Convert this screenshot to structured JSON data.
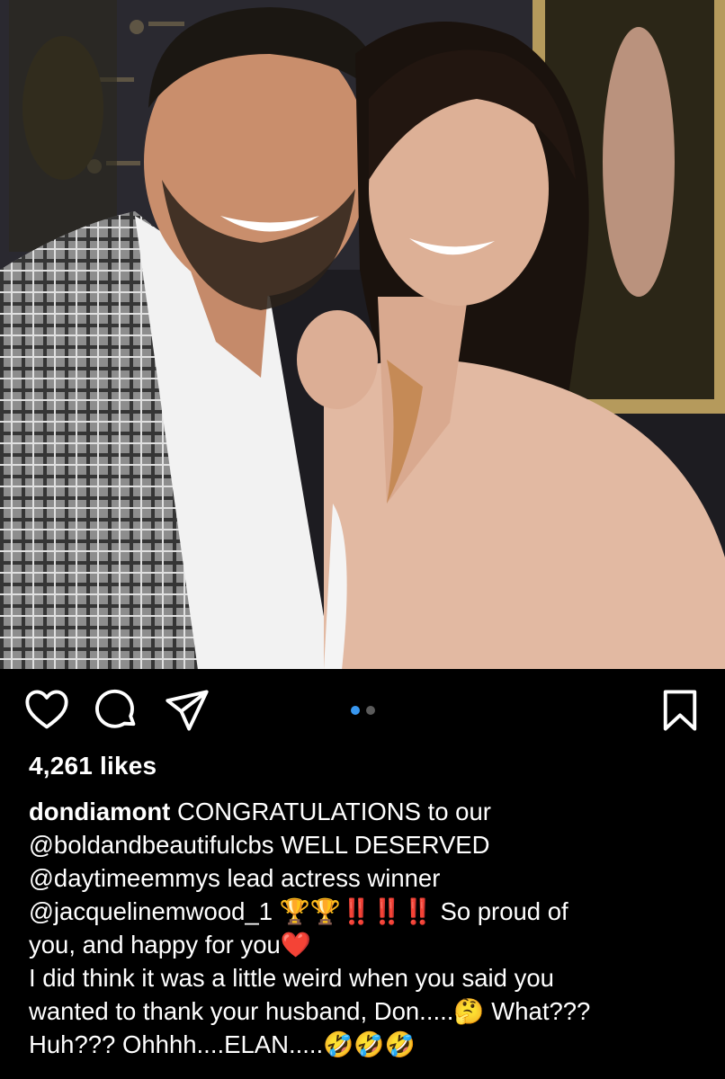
{
  "post": {
    "likes_text": "4,261 likes",
    "carousel": {
      "count": 2,
      "active_index": 0
    },
    "caption": {
      "username": "dondiamont",
      "line1": "CONGRATULATIONS to our",
      "line2": "@boldandbeautifulcbs WELL DESERVED",
      "line3": "@daytimeemmys lead actress winner",
      "line4": "@jacquelinemwood_1 🏆🏆‼️‼️‼️ So proud of",
      "line5": "you, and happy for you❤️",
      "line6": "I did think it was a little weird when you said you",
      "line7": "wanted to thank your husband, Don.....🤔 What???",
      "line8": "Huh??? Ohhhh....ELAN.....🤣🤣🤣"
    }
  },
  "icons": {
    "like": "heart-icon",
    "comment": "comment-icon",
    "share": "paper-plane-icon",
    "save": "bookmark-icon"
  },
  "colors": {
    "background": "#000000",
    "text": "#ffffff",
    "carousel_active": "#3897f0",
    "carousel_inactive": "#5b5b5b"
  }
}
